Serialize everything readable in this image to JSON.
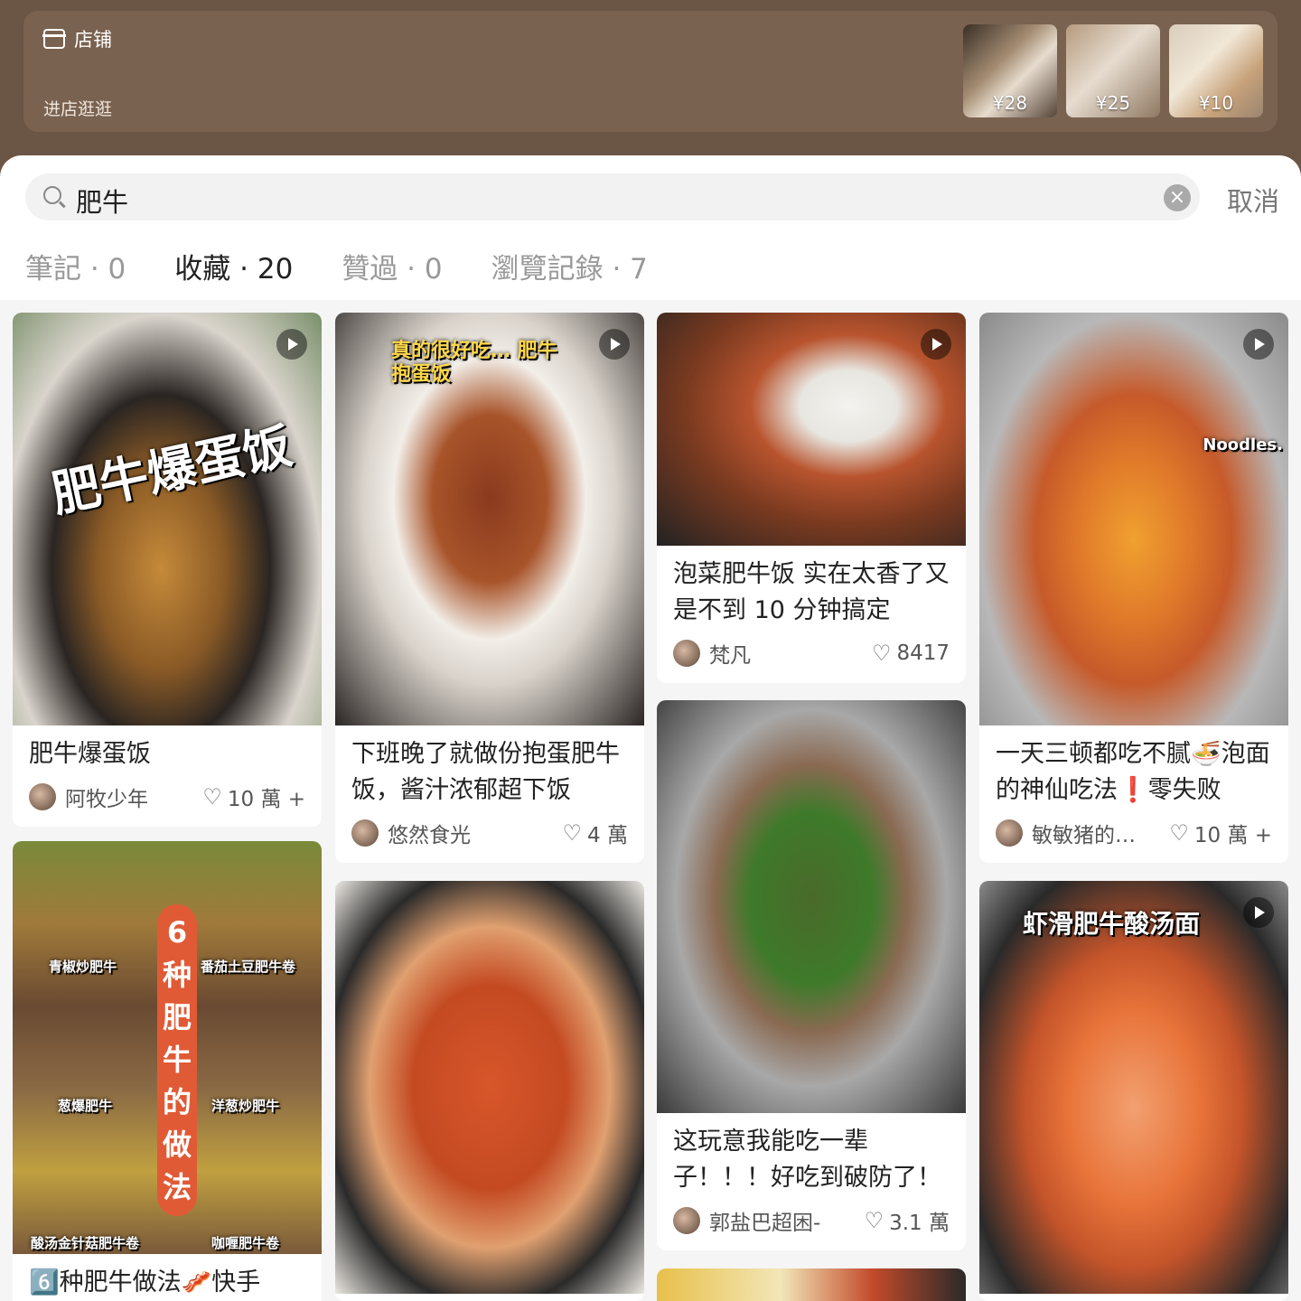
{
  "shop": {
    "title": "店铺",
    "subtitle": "进店逛逛",
    "products": [
      {
        "price": "¥28"
      },
      {
        "price": "¥25"
      },
      {
        "price": "¥10"
      }
    ]
  },
  "search": {
    "query": "肥牛",
    "cancel": "取消"
  },
  "tabs": [
    {
      "label": "筆記 · 0"
    },
    {
      "label": "收藏 · 20"
    },
    {
      "label": "贊過 · 0"
    },
    {
      "label": "瀏覽記錄 · 7"
    }
  ],
  "cards": [
    {
      "overlay": "肥牛爆蛋饭",
      "title": "肥牛爆蛋饭",
      "author": "阿牧少年",
      "likes": "10 萬 +"
    },
    {
      "overlay": "真的很好吃… 肥牛抱蛋饭",
      "title": "下班晚了就做份抱蛋肥牛饭，酱汁浓郁超下饭",
      "author": "悠然食光",
      "likes": "4 萬"
    },
    {
      "title": "泡菜肥牛饭 实在太香了又是不到 10 分钟搞定",
      "author": "梵凡",
      "likes": "8417"
    },
    {
      "overlay": "Noodles.",
      "title": "一天三顿都吃不腻🍜泡面的神仙吃法❗️零失败",
      "author": "敏敏猪的…",
      "likes": "10 萬 +"
    },
    {
      "overlay": "6种肥牛的做法",
      "title": "6️⃣种肥牛做法🥓快手",
      "labels": [
        "青椒炒肥牛",
        "番茄土豆肥牛卷",
        "葱爆肥牛",
        "洋葱炒肥牛",
        "酸汤金针菇肥牛卷",
        "咖喱肥牛卷"
      ]
    },
    {
      "title": ""
    },
    {
      "title": "这玩意我能吃一辈子！！！好吃到破防了！",
      "author": "郭盐巴超困-",
      "likes": "3.1 萬"
    },
    {
      "overlay": "虾滑肥牛酸汤面",
      "title": ""
    }
  ]
}
